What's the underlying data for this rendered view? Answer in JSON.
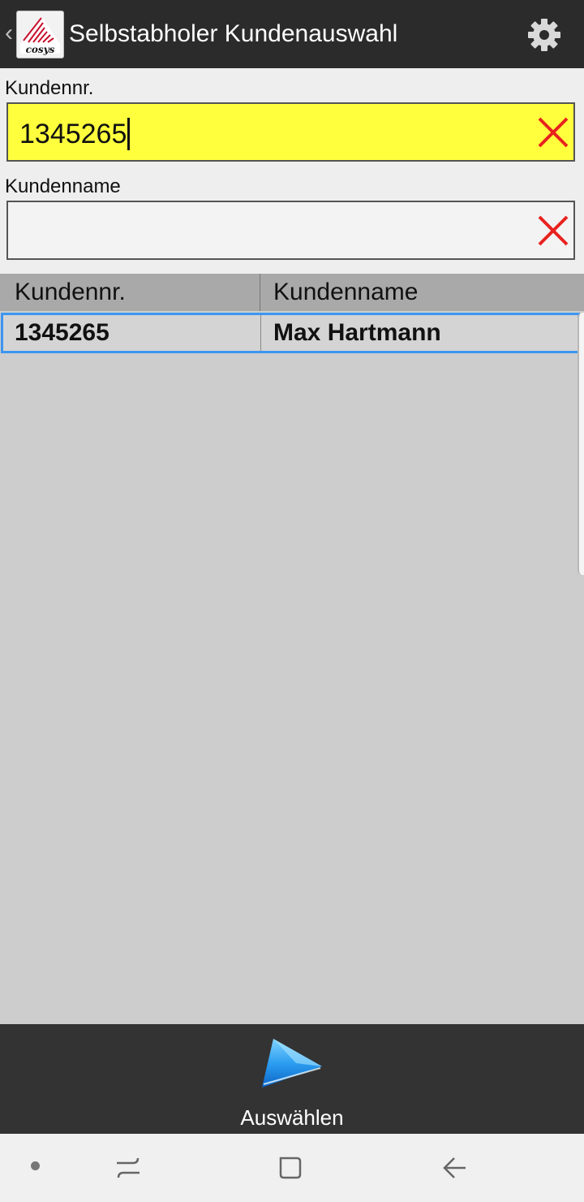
{
  "appbar": {
    "title": "Selbstabholer Kundenauswahl",
    "back_icon": "chevron-left-icon",
    "logo_icon": "app-logo",
    "settings_icon": "gear-icon"
  },
  "form": {
    "kundennr_label": "Kundennr.",
    "kundennr_value": "1345265",
    "kundenname_label": "Kundenname",
    "kundenname_value": "",
    "clear_icon": "close-icon"
  },
  "table": {
    "headers": [
      "Kundennr.",
      "Kundenname"
    ],
    "rows": [
      {
        "kundennr": "1345265",
        "kundenname": "Max Hartmann",
        "selected": true
      }
    ]
  },
  "actions": {
    "select_label": "Auswählen",
    "select_icon": "play-arrow-icon"
  },
  "system_nav": {
    "items": [
      "dot-icon",
      "recent-apps-icon",
      "home-icon",
      "back-arrow-icon"
    ]
  },
  "colors": {
    "appbar_bg": "#2b2b2b",
    "highlight_input": "#ffff3d",
    "clear_red": "#e8221e",
    "selection_border": "#3d96f0",
    "table_header_bg": "#a9a9a9",
    "list_bg": "#cdcdcd",
    "bottom_bar_bg": "#333333"
  }
}
